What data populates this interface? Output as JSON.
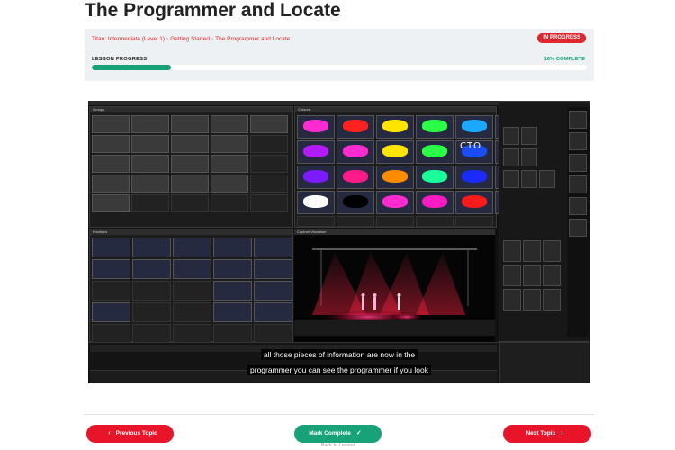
{
  "page": {
    "title": "The Programmer and Locate"
  },
  "lesson": {
    "breadcrumb": [
      "Titan: Intermediate (Level 1)",
      "Getting Started",
      "The Programmer and Locate"
    ],
    "breadcrumb_sep": "›",
    "status_badge": "IN PROGRESS",
    "progress_label": "LESSON PROGRESS",
    "progress_text": "16% COMPLETE",
    "progress_fraction": 0.16
  },
  "video": {
    "subtitle_line1": "all those pieces of information are now in the",
    "subtitle_line2": "programmer you can see the programmer if you look",
    "panels": {
      "groups": "Groups",
      "colours": "Colours",
      "positions": "Positions",
      "visualiser": "Capture Visualiser"
    },
    "cto_label": "CTO",
    "color_swatches": [
      [
        "#ff2bd0",
        "#ff2020",
        "#ffe400",
        "#2bff45",
        "#1ba9ff",
        "#ffffff"
      ],
      [
        "#b31bff",
        "#ff2bd0",
        "#ffe400",
        "#2bff45",
        "#1b4cff",
        "#ffffff"
      ],
      [
        "#7c1bff",
        "#ff1b8a",
        "#ff8b00",
        "#1bff9a",
        "#1b2bff",
        "#ffffff"
      ],
      [
        "#ffffff",
        "#000000",
        "#ff2bd0",
        "#ff1bc4",
        "#ff1b1b",
        "#ffffff"
      ]
    ]
  },
  "nav": {
    "prev_label": "Previous Topic",
    "complete_label": "Mark Complete",
    "next_label": "Next Topic",
    "back_label": "Back to Lesson"
  },
  "colors": {
    "accent_red": "#e8152a",
    "accent_green": "#17a277"
  }
}
